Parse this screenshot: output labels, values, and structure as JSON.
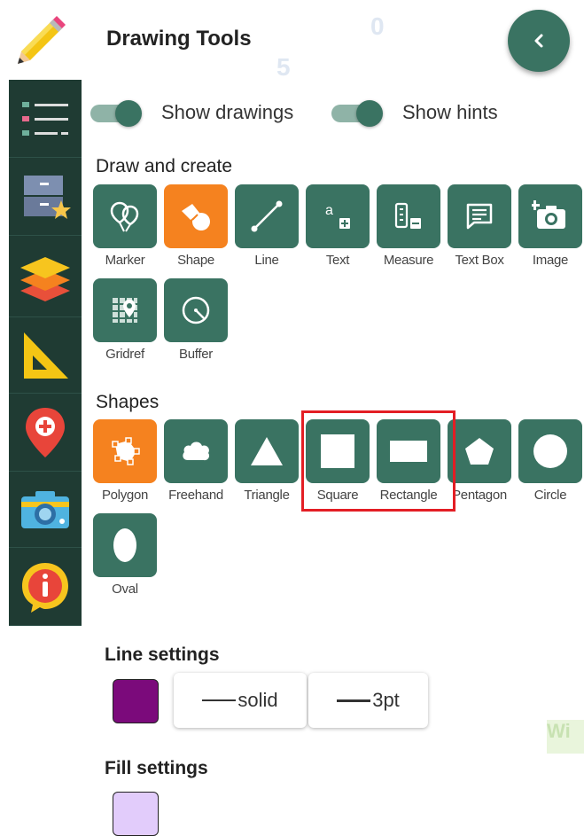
{
  "panel": {
    "title": "Drawing Tools"
  },
  "rail": {
    "items": [
      {
        "icon": "list-icon"
      },
      {
        "icon": "cabinet-star-icon"
      },
      {
        "icon": "layers-icon"
      },
      {
        "icon": "set-square-icon"
      },
      {
        "icon": "location-pin-icon"
      },
      {
        "icon": "camera-icon"
      },
      {
        "icon": "info-icon"
      }
    ]
  },
  "toggles": {
    "show_drawings": {
      "label": "Show drawings",
      "on": true
    },
    "show_hints": {
      "label": "Show hints",
      "on": true
    }
  },
  "draw_create": {
    "title": "Draw and create",
    "tools": [
      {
        "label": "Marker",
        "icon": "balloons-icon",
        "active": false
      },
      {
        "label": "Shape",
        "icon": "shapes-icon",
        "active": true
      },
      {
        "label": "Line",
        "icon": "line-icon",
        "active": false
      },
      {
        "label": "Text",
        "icon": "text-add-icon",
        "active": false
      },
      {
        "label": "Measure",
        "icon": "measure-icon",
        "active": false
      },
      {
        "label": "Text Box",
        "icon": "text-box-icon",
        "active": false
      },
      {
        "label": "Image",
        "icon": "add-photo-icon",
        "active": false
      },
      {
        "label": "Gridref",
        "icon": "gridref-icon",
        "active": false
      },
      {
        "label": "Buffer",
        "icon": "buffer-icon",
        "active": false
      }
    ]
  },
  "shapes": {
    "title": "Shapes",
    "tools": [
      {
        "label": "Polygon",
        "icon": "polygon-icon",
        "active": true
      },
      {
        "label": "Freehand",
        "icon": "cloud-icon",
        "active": false
      },
      {
        "label": "Triangle",
        "icon": "triangle-icon",
        "active": false
      },
      {
        "label": "Square",
        "icon": "square-icon",
        "active": false
      },
      {
        "label": "Rectangle",
        "icon": "rectangle-icon",
        "active": false
      },
      {
        "label": "Pentagon",
        "icon": "pentagon-icon",
        "active": false
      },
      {
        "label": "Circle",
        "icon": "circle-icon",
        "active": false
      },
      {
        "label": "Oval",
        "icon": "oval-icon",
        "active": false
      }
    ]
  },
  "line_settings": {
    "title": "Line settings",
    "color": "#7b0a7b",
    "style_label": "solid",
    "width_label": "3pt"
  },
  "fill_settings": {
    "title": "Fill settings",
    "color": "#e2ccfb"
  },
  "colors": {
    "accent": "#3a7362",
    "active": "#f5821f",
    "rail": "#1f3b33",
    "highlight": "#e31e24"
  },
  "background_glyphs": {
    "a": "0",
    "b": "5",
    "c": "Wi"
  }
}
